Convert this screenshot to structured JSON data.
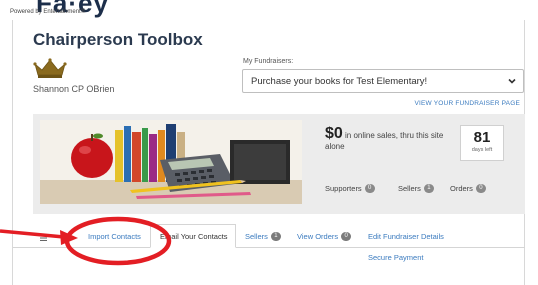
{
  "header": {
    "logo_text": "Fa·ey",
    "powered_by": "Powered by Entertainment®"
  },
  "page": {
    "title": "Chairperson Toolbox"
  },
  "user": {
    "name": "Shannon CP OBrien",
    "crown_icon": "crown-icon"
  },
  "fundraisers": {
    "label": "My Fundraisers:",
    "selected": "Purchase your books for Test Elementary!",
    "view_page_link": "VIEW YOUR FUNDRAISER PAGE"
  },
  "stats": {
    "sales_amount": "$0",
    "sales_text": "in online sales, thru this site alone",
    "days_left_value": "81",
    "days_left_label": "days left",
    "supporters_label": "Supporters",
    "supporters_count": "0",
    "sellers_label": "Sellers",
    "sellers_count": "1",
    "orders_label": "Orders",
    "orders_count": "0"
  },
  "tabs": {
    "import_contacts": "Import Contacts",
    "email_contacts": "Email Your Contacts",
    "sellers": "Sellers",
    "sellers_count": "1",
    "view_orders": "View Orders",
    "view_orders_count": "0",
    "edit_details": "Edit Fundraiser Details",
    "secure_payment": "Secure Payment"
  },
  "colors": {
    "link": "#3b7bbf",
    "annotation": "#e31e24",
    "title": "#2b3a4f",
    "crown": "#8a6a1e"
  }
}
